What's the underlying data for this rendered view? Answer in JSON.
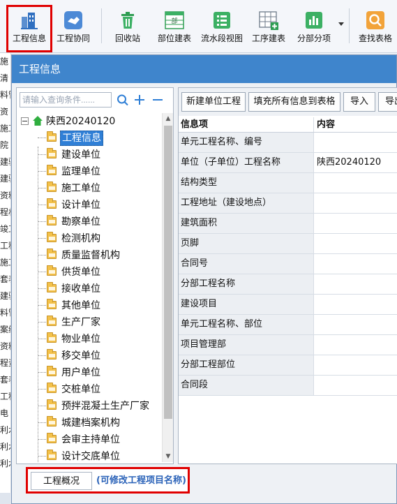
{
  "toolbar": {
    "items": [
      {
        "label": "工程信息",
        "icon": "building-icon"
      },
      {
        "label": "工程协同",
        "icon": "handshake-icon"
      },
      {
        "label": "回收站",
        "icon": "trash-icon"
      },
      {
        "label": "部位建表",
        "icon": "table-part-icon"
      },
      {
        "label": "流水段视图",
        "icon": "flow-view-icon"
      },
      {
        "label": "工序建表",
        "icon": "table-add-icon"
      },
      {
        "label": "分部分项",
        "icon": "bar-chart-icon"
      },
      {
        "label": "查找表格",
        "icon": "search-icon"
      }
    ]
  },
  "background_rows": [
    "施",
    "清",
    "料管",
    "资",
    "施工",
    "院",
    "建验",
    "建验",
    "资料",
    "程材",
    "竣工",
    "工程",
    "施工",
    "套表",
    "建验",
    "料管",
    "案维",
    "资料",
    "程资",
    "套表",
    "工程",
    "电",
    "利水",
    "利水",
    "利水"
  ],
  "dialog": {
    "title": "工程信息",
    "search": {
      "placeholder": "请输入查询条件......"
    },
    "tree": {
      "root": "陕西20240120",
      "children": [
        "工程信息",
        "建设单位",
        "监理单位",
        "施工单位",
        "设计单位",
        "勘察单位",
        "检测机构",
        "质量监督机构",
        "供货单位",
        "接收单位",
        "其他单位",
        "生产厂家",
        "物业单位",
        "移交单位",
        "用户单位",
        "交桩单位",
        "预拌混凝土生产厂家",
        "城建档案机构",
        "会审主持单位",
        "设计交底单位"
      ],
      "selected_index": 0
    },
    "buttons": {
      "new_unit": "新建单位工程",
      "fill_all": "填充所有信息到表格",
      "import": "导入",
      "export": "导出"
    },
    "grid": {
      "headers": [
        "信息项",
        "内容"
      ],
      "rows": [
        {
          "item": "单元工程名称、编号",
          "value": ""
        },
        {
          "item": "单位（子单位）工程名称",
          "value": "陕西20240120"
        },
        {
          "item": "结构类型",
          "value": ""
        },
        {
          "item": "工程地址（建设地点）",
          "value": ""
        },
        {
          "item": "建筑面积",
          "value": ""
        },
        {
          "item": "页脚",
          "value": ""
        },
        {
          "item": "合同号",
          "value": ""
        },
        {
          "item": "分部工程名称",
          "value": ""
        },
        {
          "item": "建设项目",
          "value": ""
        },
        {
          "item": "单元工程名称、部位",
          "value": ""
        },
        {
          "item": "项目管理部",
          "value": ""
        },
        {
          "item": "分部工程部位",
          "value": ""
        },
        {
          "item": "合同段",
          "value": ""
        }
      ]
    },
    "tabs": {
      "overview": "工程概况",
      "rename_link": "(可修改工程项目名称)"
    }
  },
  "colors": {
    "title_bar": "#3f85cc",
    "selection": "#2f7fd6",
    "highlight_box": "#e00000",
    "link": "#2a62b8"
  }
}
